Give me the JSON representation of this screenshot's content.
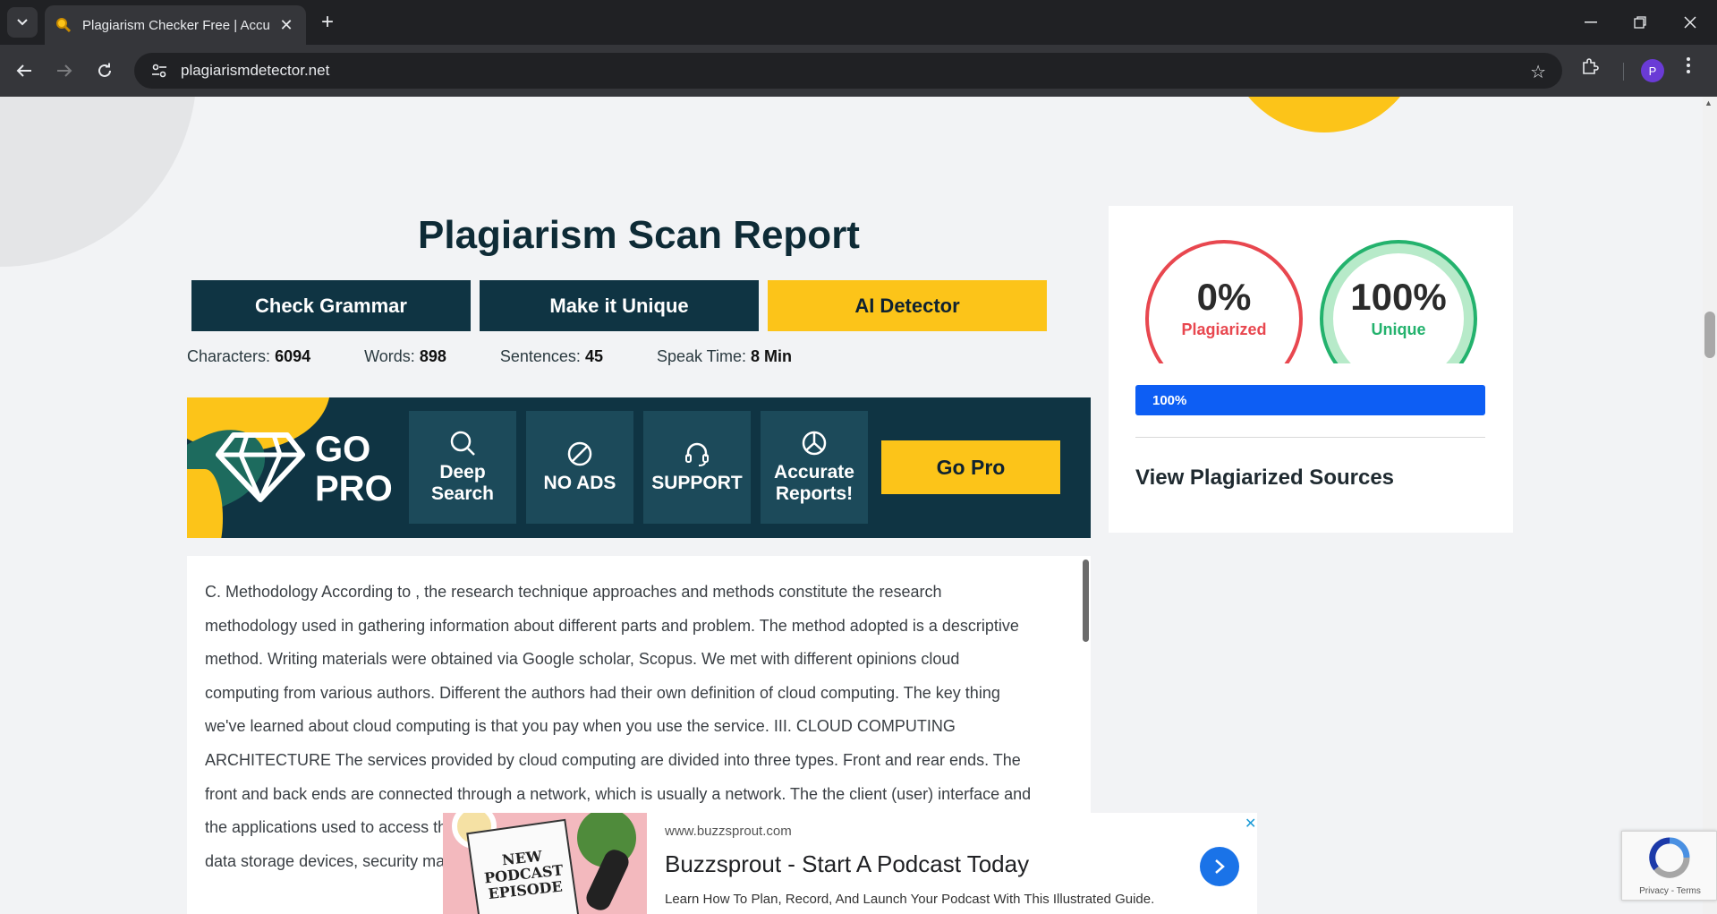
{
  "browser": {
    "tab_title": "Plagiarism Checker Free | Accur",
    "url": "plagiarismdetector.net",
    "avatar_letter": "P"
  },
  "page": {
    "title": "Plagiarism Scan Report",
    "buttons": {
      "check_grammar": "Check Grammar",
      "make_unique": "Make it Unique",
      "ai_detector": "AI Detector"
    },
    "stats": [
      {
        "label": "Characters:",
        "value": "6094"
      },
      {
        "label": "Words:",
        "value": "898"
      },
      {
        "label": "Sentences:",
        "value": "45"
      },
      {
        "label": "Speak Time:",
        "value": "8 Min"
      }
    ],
    "gopro": {
      "line1": "GO",
      "line2": "PRO",
      "features": [
        {
          "label1": "Deep",
          "label2": "Search",
          "icon": "search-icon"
        },
        {
          "label1": "NO ADS",
          "label2": "",
          "icon": "no-ads-icon"
        },
        {
          "label1": "SUPPORT",
          "label2": "",
          "icon": "headset-icon"
        },
        {
          "label1": "Accurate",
          "label2": "Reports!",
          "icon": "pie-chart-icon"
        }
      ],
      "button": "Go Pro"
    },
    "content_text": "C. Methodology According to , the research technique approaches and methods constitute the research methodology used in gathering information about different parts and problem. The method adopted is a descriptive method. Writing materials were obtained via Google scholar, Scopus. We met with different opinions cloud computing from various authors. Different the authors had their own definition of cloud computing. The key thing we've learned about cloud computing is that you pay when you use the service. III. CLOUD COMPUTING ARCHITECTURE The services provided by cloud computing are divided into three types. Front and rear ends. The front and back ends are connected through a network, which is usually a network. The the client (user) interface and the applications used to access the cloud. The main components are on the back end client computers, servers and data storage devices, security management, operation monitoring and service management."
  },
  "result": {
    "plagiarized_value": "0%",
    "plagiarized_label": "Plagiarized",
    "unique_value": "100%",
    "unique_label": "Unique",
    "progress_fraction": 1.0,
    "progress_label": "100%",
    "view_sources": "View Plagiarized Sources",
    "colors": {
      "plagiarized": "#e8474f",
      "unique": "#23b26d",
      "progress": "#0d5ef4"
    }
  },
  "ad": {
    "url": "www.buzzsprout.com",
    "title": "Buzzsprout - Start A Podcast Today",
    "description": "Learn How To Plan, Record, And Launch Your Podcast With This Illustrated Guide.",
    "image_text": "NEW PODCAST EPISODE"
  },
  "recaptcha": {
    "terms": "Privacy - Terms"
  }
}
